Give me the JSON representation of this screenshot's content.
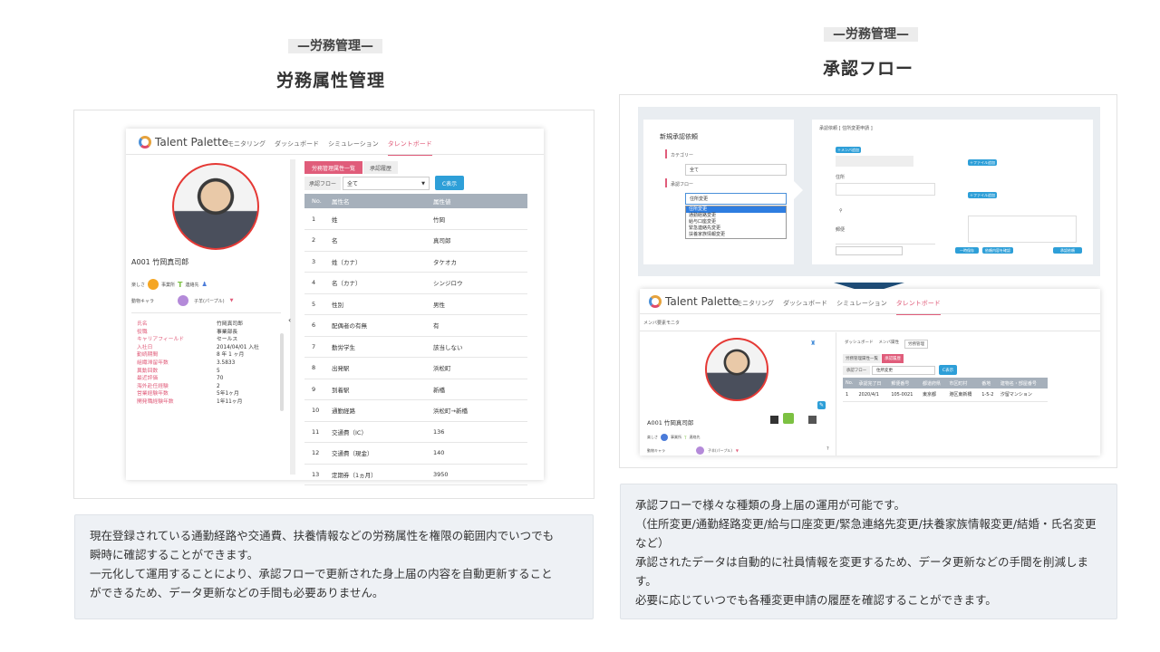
{
  "left": {
    "tag": "—労務管理—",
    "title": "労務属性管理",
    "app": {
      "logo": "Talent Palette",
      "nav": [
        "モニタリング",
        "ダッシュボード",
        "シミュレーション",
        "タレントボード"
      ],
      "tabs": [
        "労務管理属性一覧",
        "承認履歴"
      ],
      "filter_label": "承認フロー",
      "filter_value": "全て",
      "show_button": "C表示",
      "emp_name": "A001 竹岡真司郎",
      "badges": [
        "楽しさ",
        "事業所",
        "連絡先"
      ],
      "chara_label": "動物キャラ",
      "chara_value": "子羊(パープル)",
      "profile": [
        [
          "氏名",
          "竹岡真司郎"
        ],
        [
          "役職",
          "事業部長"
        ],
        [
          "キャリアフィールド",
          "セールス"
        ],
        [
          "入社日",
          "2014/04/01 入社"
        ],
        [
          "勤続期間",
          "8 年 1 ヶ月"
        ],
        [
          "組織滞留年数",
          "3.5833"
        ],
        [
          "異動回数",
          "5"
        ],
        [
          "最近評価",
          "70"
        ],
        [
          "海外赴任経験",
          "2"
        ],
        [
          "営業経験年数",
          "5年1ヶ月"
        ],
        [
          "開発職経験年数",
          "1年11ヶ月"
        ]
      ],
      "table_headers": [
        "No.",
        "属性名",
        "属性値"
      ],
      "rows": [
        [
          "1",
          "姓",
          "竹岡"
        ],
        [
          "2",
          "名",
          "真司郎"
        ],
        [
          "3",
          "姓（カナ）",
          "タケオカ"
        ],
        [
          "4",
          "名（カナ）",
          "シンジロウ"
        ],
        [
          "5",
          "性別",
          "男性"
        ],
        [
          "6",
          "配偶者の有無",
          "有"
        ],
        [
          "7",
          "勤労学生",
          "該当しない"
        ],
        [
          "8",
          "出発駅",
          "浜松町"
        ],
        [
          "9",
          "到着駅",
          "新橋"
        ],
        [
          "10",
          "通勤経路",
          "浜松町→新橋"
        ],
        [
          "11",
          "交通費（IC）",
          "136"
        ],
        [
          "12",
          "交通費（現金）",
          "140"
        ],
        [
          "13",
          "定期券（1ヵ月）",
          "3950"
        ]
      ]
    },
    "description": [
      "現在登録されている通勤経路や交通費、扶養情報などの労務属性を権限の範囲内でいつでも",
      "瞬時に確認することができます。",
      "一元化して運用することにより、承認フローで更新された身上届の内容を自動更新すること",
      "ができるため、データ更新などの手間も必要ありません。"
    ]
  },
  "right": {
    "tag": "—労務管理—",
    "title": "承認フロー",
    "request": {
      "title": "新規承認依頼",
      "category_label": "カテゴリー",
      "category_value": "全て",
      "flow_label": "承認フロー",
      "flow_value": "住所変更",
      "options": [
        "住所変更",
        "通勤経路変更",
        "給与口座変更",
        "緊急連絡先変更",
        "扶養家族情報変更"
      ],
      "form_header": "承認依頼 [ 住所変更申請 ]",
      "f_add_member": "＋メンバ追加",
      "f_address": "住所",
      "f_postal": "郵便",
      "f_attach1": "＋ファイル追加",
      "f_attach2": "＋ファイル追加",
      "f_btn1": "一時保存",
      "f_btn2": "依頼内容を確認",
      "f_btn3": "承認依頼"
    },
    "app": {
      "logo": "Talent Palette",
      "nav": [
        "モニタリング",
        "ダッシュボード",
        "シミュレーション",
        "タレントボード"
      ],
      "sub": "メンバ要素モニタ",
      "tabs": [
        "ダッシュボード",
        "メンバ属性",
        "労務管理"
      ],
      "subtabs": [
        "労務管理属性一覧",
        "承認履歴"
      ],
      "filter_label": "承認フロー",
      "filter_value": "住所変更",
      "show_button": "C表示",
      "headers": [
        "No.",
        "承認完了日",
        "郵便番号",
        "都道府県",
        "市区町村",
        "番地",
        "建物名・部屋番号"
      ],
      "row": [
        "1",
        "2020/4/1",
        "105-0021",
        "東京都",
        "港区東新橋",
        "1-5-2",
        "汐留マンション"
      ],
      "emp_name": "A001 竹岡真司郎",
      "chara_label": "動物キャラ",
      "chara_value": "子羊(パープル)"
    },
    "description": [
      "承認フローで様々な種類の身上届の運用が可能です。",
      "（住所変更/通勤経路変更/給与口座変更/緊急連絡先変更/扶養家族情報変更/結婚・氏名変更",
      "など）",
      "承認されたデータは自動的に社員情報を変更するため、データ更新などの手間を削減しま",
      "す。",
      "必要に応じていつでも各種変更申請の履歴を確認することができます。"
    ]
  }
}
